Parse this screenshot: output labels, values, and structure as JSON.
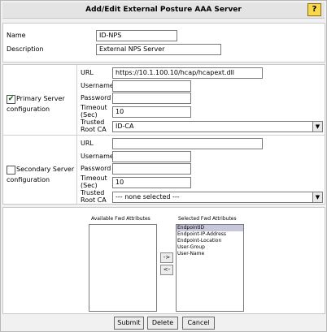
{
  "dialog": {
    "title": "Add/Edit External Posture AAA Server",
    "help_icon": "?"
  },
  "general": {
    "name_label": "Name",
    "name_value": "ID-NPS",
    "description_label": "Description",
    "description_value": "External NPS Server"
  },
  "primary": {
    "checkbox_checked": true,
    "checkbox_mark": "✔",
    "label_line1": "Primary Server",
    "label_line2": "configuration",
    "url_label": "URL",
    "url_value": "https://10.1.100.10/hcap/hcapext.dll",
    "username_label": "Username",
    "username_value": "",
    "password_label": "Password",
    "password_value": "",
    "timeout_label_line1": "Timeout",
    "timeout_label_line2": "(Sec)",
    "timeout_value": "10",
    "ca_label_line1": "Trusted",
    "ca_label_line2": "Root CA",
    "ca_value": "ID-CA"
  },
  "secondary": {
    "checkbox_checked": false,
    "label_line1": "Secondary Server",
    "label_line2": "configuration",
    "url_label": "URL",
    "url_value": "",
    "username_label": "Username",
    "username_value": "",
    "password_label": "Password",
    "password_value": "",
    "timeout_label_line1": "Timeout",
    "timeout_label_line2": "(Sec)",
    "timeout_value": "10",
    "ca_label_line1": "Trusted",
    "ca_label_line2": "Root CA",
    "ca_value": "--- none selected ---"
  },
  "attributes": {
    "available_label": "Available Fwd Attributes",
    "available_items": [],
    "selected_label": "Selected Fwd Attributes",
    "selected_items": [
      "EndpointID",
      "Endpoint-IP-Address",
      "Endpoint-Location",
      "User-Group",
      "User-Name"
    ],
    "add_button": "->",
    "remove_button": "<-"
  },
  "footer": {
    "submit": "Submit",
    "delete": "Delete",
    "cancel": "Cancel"
  },
  "icons": {
    "dropdown": "▼"
  }
}
